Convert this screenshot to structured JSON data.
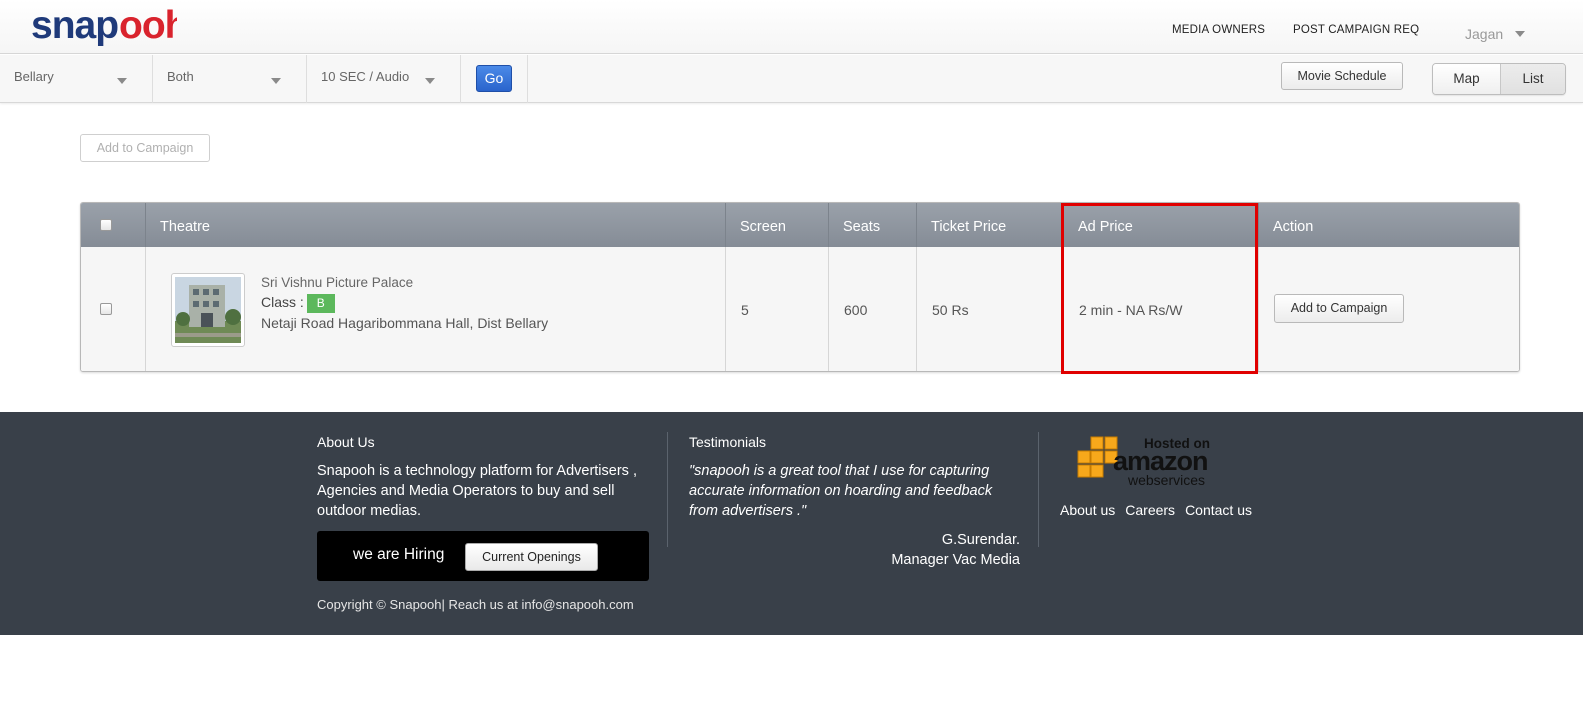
{
  "header": {
    "logo_text": "snapooh",
    "nav": [
      "MEDIA OWNERS",
      "POST CAMPAIGN REQ"
    ],
    "user": "Jagan"
  },
  "filters": {
    "city": "Bellary",
    "type": "Both",
    "duration": "10 SEC / Audio",
    "go_label": "Go",
    "movie_schedule_label": "Movie Schedule",
    "view_map_label": "Map",
    "view_list_label": "List"
  },
  "toolbar": {
    "add_to_campaign_label": "Add to Campaign"
  },
  "table": {
    "columns": [
      "Theatre",
      "Screen",
      "Seats",
      "Ticket Price",
      "Ad Price",
      "Action"
    ],
    "rows": [
      {
        "name": "Sri Vishnu Picture Palace",
        "class_label": "Class :",
        "class_value": "B",
        "address": "Netaji Road Hagaribommana Hall, Dist Bellary",
        "screen": "5",
        "seats": "600",
        "ticket_price": "50 Rs",
        "ad_price": "2 min - NA Rs/W",
        "action_label": "Add to Campaign"
      }
    ]
  },
  "footer": {
    "about_title": "About Us",
    "about_text": "Snapooh is a technology platform for Advertisers , Agencies and Media Operators to buy and sell outdoor medias.",
    "hiring_text": "we are Hiring",
    "openings_label": "Current Openings",
    "copyright": "Copyright © Snapooh| Reach us at info@snapooh.com",
    "testimonials_title": "Testimonials",
    "testimonial_quote": "\"snapooh is a great tool that I use for capturing accurate information on hoarding and feedback from advertisers .\"",
    "testimonial_author": "G.Surendar.",
    "testimonial_role": "Manager Vac Media",
    "hosted_on": "Hosted on",
    "amazon": "amazon",
    "webservices": "webservices",
    "links": [
      "About us",
      "Careers",
      "Contact us"
    ]
  },
  "colors": {
    "logo_blue": "#1f3a7a",
    "logo_red": "#d9232d",
    "header_row": "#8e959e",
    "footer_bg": "#394049",
    "class_badge": "#5cb85c",
    "highlight": "#e00000",
    "go_button": "#2f6fd6"
  }
}
